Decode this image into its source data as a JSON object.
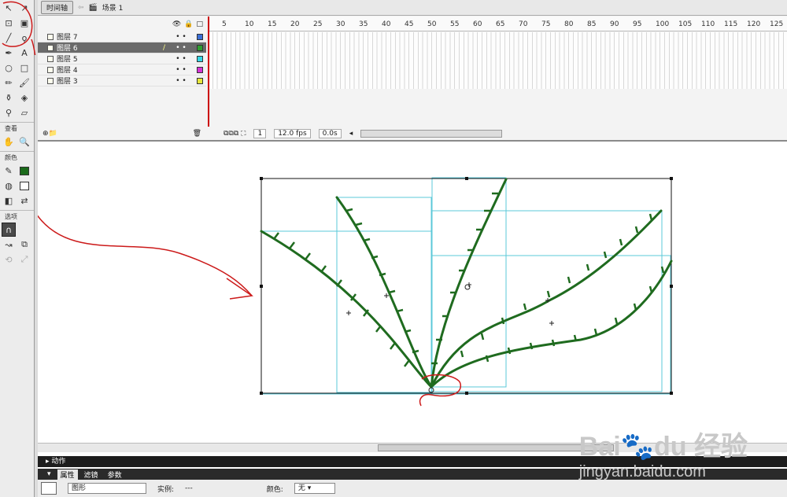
{
  "timeline": {
    "tab_label": "时间轴",
    "scene_label": "场景 1",
    "ruler_ticks": [
      "5",
      "10",
      "15",
      "20",
      "25",
      "30",
      "35",
      "40",
      "45",
      "50",
      "55",
      "60",
      "65",
      "70",
      "75",
      "80",
      "85",
      "90",
      "95",
      "100",
      "105",
      "110",
      "115",
      "120",
      "125"
    ],
    "layers": [
      {
        "name": "图层 7",
        "color": "#3b6fd6",
        "selected": false
      },
      {
        "name": "图层 6",
        "color": "#2e9e2e",
        "selected": true
      },
      {
        "name": "图层 5",
        "color": "#33d6e6",
        "selected": false
      },
      {
        "name": "图层 4",
        "color": "#d633d6",
        "selected": false
      },
      {
        "name": "图层 3",
        "color": "#e6e63b",
        "selected": false
      }
    ],
    "frame_number": "1",
    "fps": "12.0 fps",
    "elapsed": "0.0s"
  },
  "tools": {
    "section_view": "查看",
    "section_color": "颜色",
    "section_options": "选项"
  },
  "panels": {
    "actions_label": "动作",
    "tab_properties": "属性",
    "tab_filters": "滤镜",
    "tab_params": "参数",
    "symbol_type": "图形",
    "instance_label": "实例:",
    "instance_value": "---",
    "color_label": "颜色:",
    "color_value": "无"
  },
  "watermark": {
    "brand": "Bai",
    "brand2": "经验",
    "url": "jingyan.baidu.com"
  }
}
